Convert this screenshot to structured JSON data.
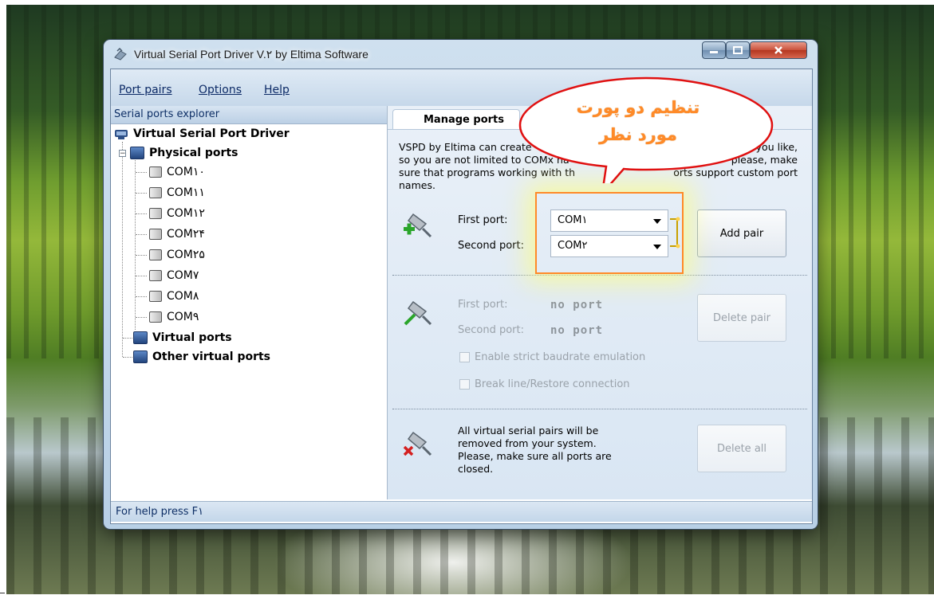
{
  "window": {
    "title": "Virtual Serial Port Driver V.۲ by Eltima Software"
  },
  "menu": {
    "items": [
      "Port pairs",
      "Options",
      "Help"
    ]
  },
  "explorer": {
    "header": "Serial ports explorer",
    "root": "Virtual Serial Port Driver",
    "physical": "Physical ports",
    "ports": [
      "COM۱۰",
      "COM۱۱",
      "COM۱۲",
      "COM۲۴",
      "COM۲۵",
      "COM۷",
      "COM۸",
      "COM۹"
    ],
    "virtual": "Virtual ports",
    "other": "Other virtual ports"
  },
  "tab": {
    "label": "Manage ports"
  },
  "create": {
    "desc_lines": [
      "VSPD by Eltima can create",
      "you like,",
      "so you are not limited to COMx na",
      "please, make",
      "sure that programs working with th",
      "orts support custom port",
      "names."
    ],
    "first_label": "First port:",
    "second_label": "Second port:",
    "first_value": "COM۱",
    "second_value": "COM۲",
    "add_button": "Add pair"
  },
  "remove": {
    "first_label": "First port:",
    "second_label": "Second port:",
    "first_value": "no port",
    "second_value": "no port",
    "delete_button": "Delete pair",
    "strict_label": "Enable strict baudrate emulation",
    "break_label": "Break line/Restore connection"
  },
  "deleteall": {
    "text": [
      "All virtual serial pairs will be",
      "removed from your system.",
      "Please, make sure all ports are",
      "closed."
    ],
    "button": "Delete all"
  },
  "status": {
    "text": "For help press F۱"
  },
  "annotation": {
    "line1": "تنظیم دو پورت",
    "line2": "مورد نظر",
    "color": "#ff8a28"
  }
}
